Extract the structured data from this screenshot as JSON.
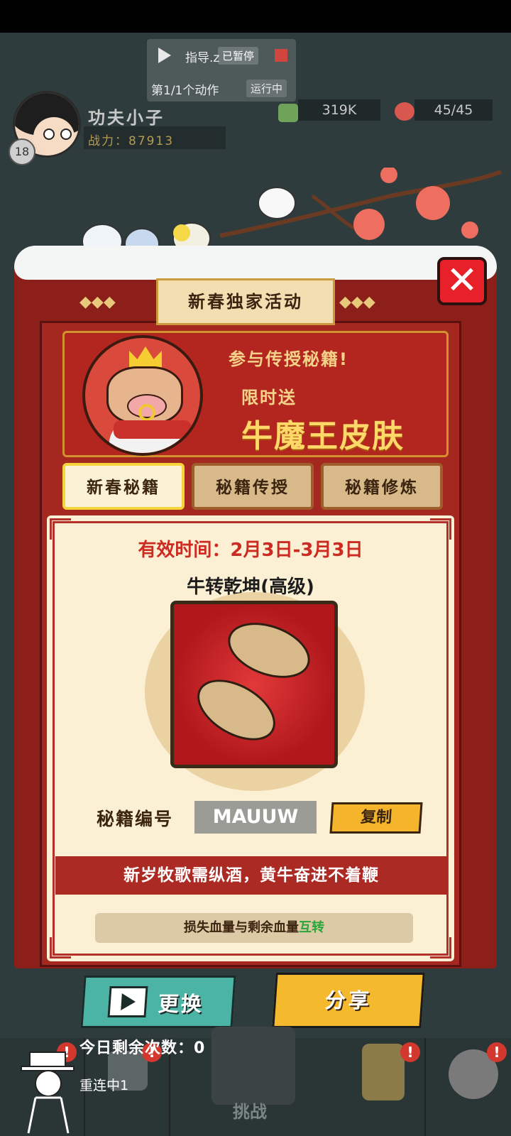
{
  "macro_overlay": {
    "title": "指导.z",
    "paused_label": "已暂停",
    "action_count": "第1/1个动作",
    "running_label": "运行中"
  },
  "player": {
    "name": "功夫小子",
    "power": "战力：87913",
    "level": "18"
  },
  "resources": {
    "coins": "319K",
    "energy": "45/45"
  },
  "popup": {
    "title": "新春独家活动",
    "close_icon": "close-icon",
    "banner": {
      "line1": "参与传授秘籍!",
      "line2": "限时送",
      "line3": "牛魔王皮肤"
    },
    "tabs": [
      {
        "label": "新春秘籍",
        "active": true
      },
      {
        "label": "秘籍传授",
        "active": false
      },
      {
        "label": "秘籍修炼",
        "active": false
      }
    ],
    "card": {
      "valid_time": "有效时间：2月3日-3月3日",
      "skill_name": "牛转乾坤(高级)",
      "code_label": "秘籍编号",
      "code_value": "MAUUW",
      "copy_label": "复制",
      "poem": "新岁牧歌需纵酒，黄牛奋进不着鞭",
      "desc_prefix": "损失血量与剩余血量",
      "desc_highlight": "互转"
    }
  },
  "actions": {
    "change_label": "更换",
    "share_label": "分享"
  },
  "bottom_nav": {
    "remaining": "今日剩余次数：0",
    "reconnecting": "重连中1",
    "challenge": "挑战",
    "alert_mark": "!"
  },
  "colors": {
    "popup_red": "#a42720",
    "accent_gold": "#f5b92e",
    "teal_button": "#4bb4a4",
    "highlight_green": "#2aa63a"
  }
}
